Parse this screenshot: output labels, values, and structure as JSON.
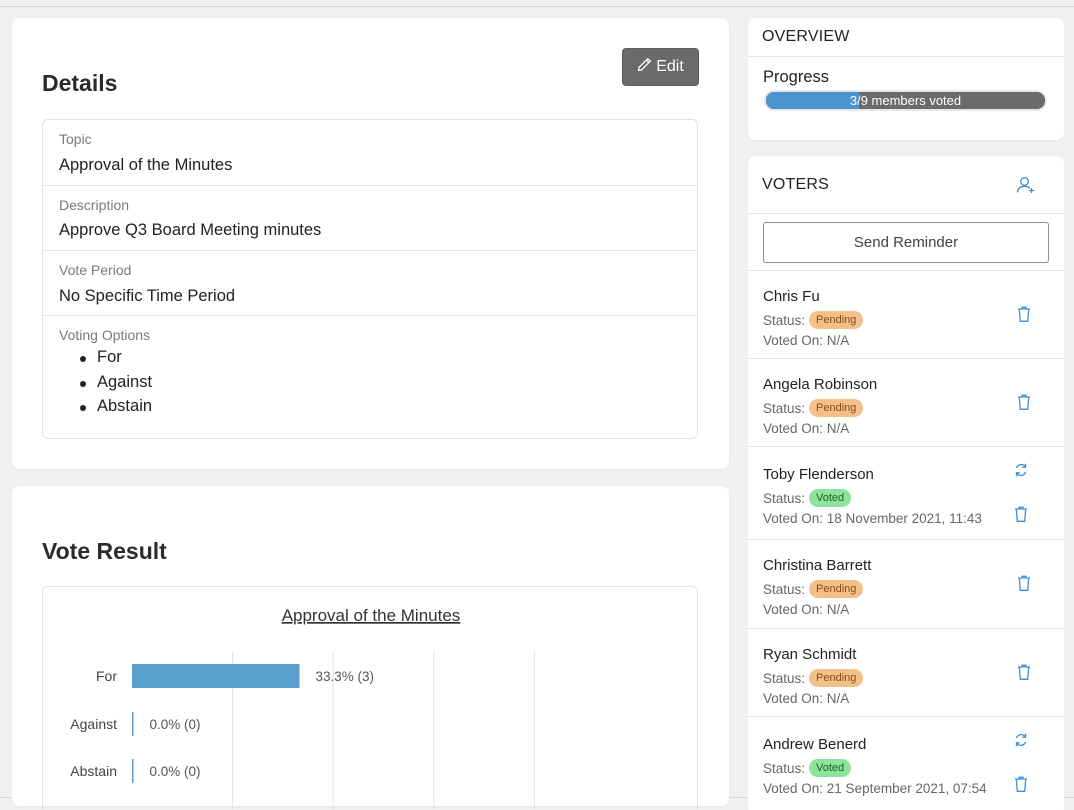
{
  "colors": {
    "accent": "#4a93cf",
    "pending": "#f3c089",
    "voted": "#8ee39b",
    "icon": "#3a8fd6",
    "edit_button": "#6b6b6b"
  },
  "details": {
    "title": "Details",
    "edit_label": "Edit",
    "fields": {
      "topic_label": "Topic",
      "topic_value": "Approval of the Minutes",
      "description_label": "Description",
      "description_value": "Approve Q3 Board Meeting minutes",
      "period_label": "Vote Period",
      "period_value": "No Specific Time Period",
      "options_label": "Voting Options",
      "options": [
        "For",
        "Against",
        "Abstain"
      ]
    }
  },
  "vote_result": {
    "title": "Vote Result"
  },
  "chart_data": {
    "type": "bar",
    "orientation": "horizontal",
    "title": "Approval of the Minutes",
    "categories": [
      "For",
      "Against",
      "Abstain"
    ],
    "values": [
      33.3,
      0.0,
      0.0
    ],
    "counts": [
      3,
      0,
      0
    ],
    "labels": [
      "33.3% (3)",
      "0.0% (0)",
      "0.0% (0)"
    ],
    "xlim": [
      0,
      100
    ],
    "grid": true,
    "bar_color": "#5aa0cf"
  },
  "overview": {
    "header": "OVERVIEW",
    "progress_label": "Progress",
    "progress_text": "3/9 members voted",
    "progress_fraction": 0.333
  },
  "voters": {
    "header": "VOTERS",
    "reminder_label": "Send Reminder",
    "status_prefix": "Status:",
    "list": [
      {
        "name": "Chris Fu",
        "status": "Pending",
        "voted_on": "Voted On: N/A",
        "revote": false
      },
      {
        "name": "Angela Robinson",
        "status": "Pending",
        "voted_on": "Voted On: N/A",
        "revote": false
      },
      {
        "name": "Toby Flenderson",
        "status": "Voted",
        "voted_on": "Voted On: 18 November 2021, 11:43",
        "revote": true
      },
      {
        "name": "Christina Barrett",
        "status": "Pending",
        "voted_on": "Voted On: N/A",
        "revote": false
      },
      {
        "name": "Ryan Schmidt",
        "status": "Pending",
        "voted_on": "Voted On: N/A",
        "revote": false
      },
      {
        "name": "Andrew Benerd",
        "status": "Voted",
        "voted_on": "Voted On: 21 September 2021, 07:54",
        "revote": true
      }
    ]
  }
}
